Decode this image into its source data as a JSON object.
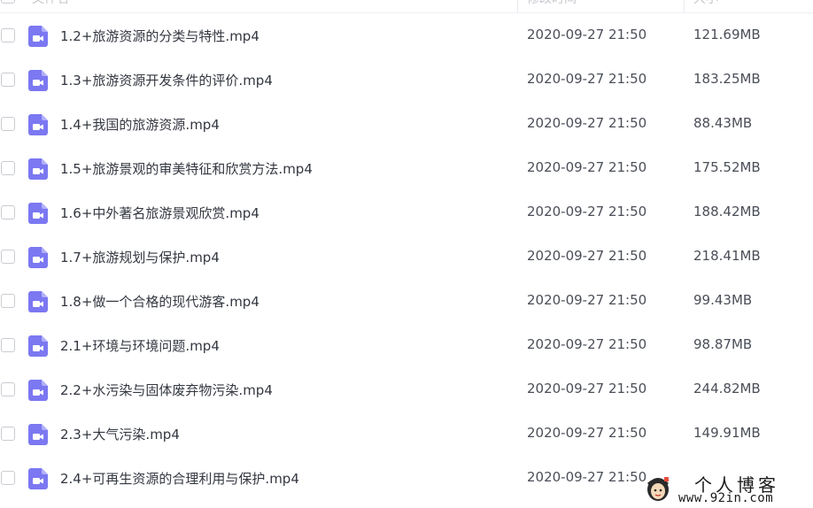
{
  "colors": {
    "icon_purple": "#7b78f2",
    "text_primary": "#333740",
    "text_secondary": "#4a4e57"
  },
  "header": {
    "name_col": "文件名",
    "date_col": "修改时间",
    "size_col": "大小"
  },
  "files": [
    {
      "name": "1.2+旅游资源的分类与特性.mp4",
      "modified": "2020-09-27 21:50",
      "size": "121.69MB",
      "icon": "video-file-icon"
    },
    {
      "name": "1.3+旅游资源开发条件的评价.mp4",
      "modified": "2020-09-27 21:50",
      "size": "183.25MB",
      "icon": "video-file-icon"
    },
    {
      "name": "1.4+我国的旅游资源.mp4",
      "modified": "2020-09-27 21:50",
      "size": "88.43MB",
      "icon": "video-file-icon"
    },
    {
      "name": "1.5+旅游景观的审美特征和欣赏方法.mp4",
      "modified": "2020-09-27 21:50",
      "size": "175.52MB",
      "icon": "video-file-icon"
    },
    {
      "name": "1.6+中外著名旅游景观欣赏.mp4",
      "modified": "2020-09-27 21:50",
      "size": "188.42MB",
      "icon": "video-file-icon"
    },
    {
      "name": "1.7+旅游规划与保护.mp4",
      "modified": "2020-09-27 21:50",
      "size": "218.41MB",
      "icon": "video-file-icon"
    },
    {
      "name": "1.8+做一个合格的现代游客.mp4",
      "modified": "2020-09-27 21:50",
      "size": "99.43MB",
      "icon": "video-file-icon"
    },
    {
      "name": "2.1+环境与环境问题.mp4",
      "modified": "2020-09-27 21:50",
      "size": "98.87MB",
      "icon": "video-file-icon"
    },
    {
      "name": "2.2+水污染与固体废弃物污染.mp4",
      "modified": "2020-09-27 21:50",
      "size": "244.82MB",
      "icon": "video-file-icon"
    },
    {
      "name": "2.3+大气污染.mp4",
      "modified": "2020-09-27 21:50",
      "size": "149.91MB",
      "icon": "video-file-icon"
    },
    {
      "name": "2.4+可再生资源的合理利用与保护.mp4",
      "modified": "2020-09-27 21:50",
      "size": "",
      "icon": "video-file-icon"
    }
  ],
  "watermark": {
    "title": "个人博客",
    "url": "www.92in.com"
  }
}
